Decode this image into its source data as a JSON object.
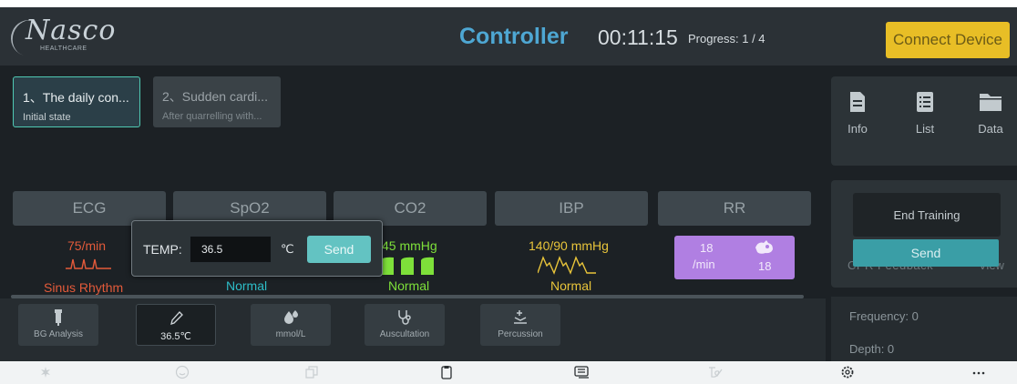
{
  "header": {
    "logo_main": "Nasco",
    "logo_sub": "HEALTHCARE",
    "title": "Controller",
    "timer": "00:11:15",
    "progress": "Progress: 1 / 4",
    "connect_label": "Connect Device"
  },
  "scenarios": [
    {
      "title": "1、The daily con...",
      "subtitle": "Initial state"
    },
    {
      "title": "2、Sudden cardi...",
      "subtitle": "After quarrelling with..."
    }
  ],
  "side": {
    "items": [
      {
        "label": "Info",
        "icon": "document-icon"
      },
      {
        "label": "List",
        "icon": "list-icon"
      },
      {
        "label": "Data",
        "icon": "folder-icon"
      }
    ],
    "end_training": "End Training",
    "cpr_feedback": "CPR Feedback",
    "cpr_view": "View",
    "send": "Send",
    "frequency": "Frequency: 0",
    "depth": "Depth: 0"
  },
  "vitals": {
    "tabs": [
      "ECG",
      "SpO2",
      "CO2",
      "IBP",
      "RR"
    ],
    "ecg_value": "75/min",
    "ecg_status": "Sinus Rhythm",
    "spo2_status": "Normal",
    "co2_value": "45 mmHg",
    "co2_status": "Normal",
    "ibp_value": "140/90 mmHg",
    "ibp_status": "Normal",
    "rr_value": "18",
    "rr_unit": "/min",
    "rr_count": "18"
  },
  "temp_popup": {
    "label": "TEMP:",
    "value": "36.5",
    "unit": "℃",
    "send_label": "Send"
  },
  "tools": [
    {
      "label": "BG Analysis",
      "icon": "blood-tube-icon"
    },
    {
      "label": "36.5℃",
      "icon": "pencil-icon"
    },
    {
      "label": "mmol/L",
      "icon": "drops-icon"
    },
    {
      "label": "Auscultation",
      "icon": "stethoscope-icon"
    },
    {
      "label": "Percussion",
      "icon": "percussion-icon"
    }
  ],
  "bottom_bar": [
    "bell-icon",
    "smile-icon",
    "copy-icon",
    "clipboard-icon",
    "keyboard-icon",
    "signature-icon",
    "settings-icon",
    "more-icon"
  ],
  "colors": {
    "accent_blue": "#4ea7d3",
    "connect_yellow": "#e8be26",
    "ecg_red": "#e35a3a",
    "spo2_teal": "#2dbec8",
    "co2_green": "#7ee03a",
    "ibp_yellow": "#e8c43a",
    "rr_purple": "#b07fe2"
  }
}
